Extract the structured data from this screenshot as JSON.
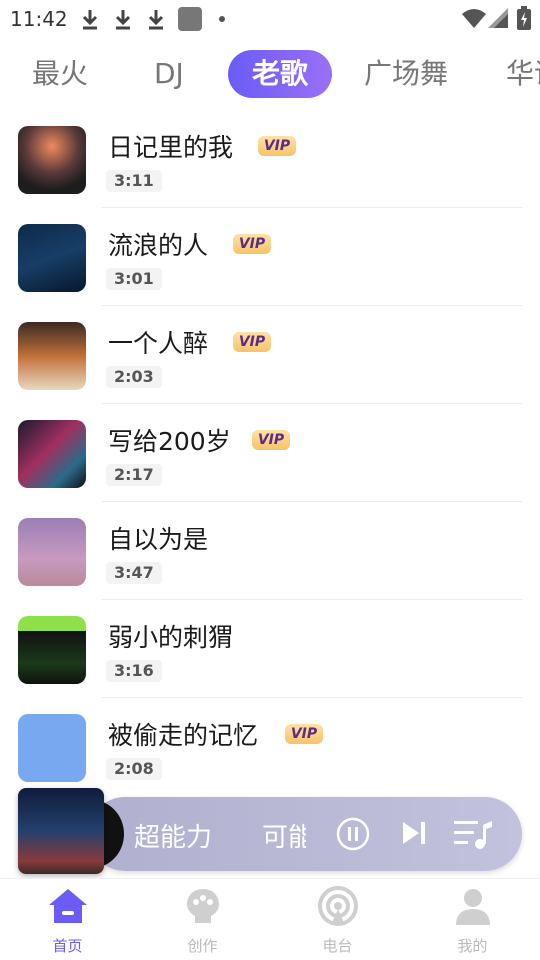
{
  "status_bar": {
    "time": "11:42",
    "icons": [
      "download-icon",
      "download-icon",
      "download-icon",
      "app-notification-icon",
      "dot-icon",
      "wifi-icon",
      "signal-icon",
      "battery-icon"
    ]
  },
  "tabs": {
    "items": [
      {
        "label": "最火"
      },
      {
        "label": "DJ"
      },
      {
        "label": "老歌"
      },
      {
        "label": "广场舞"
      },
      {
        "label": "华语"
      }
    ],
    "active_index": 2,
    "active_color": "#6b5cf6"
  },
  "songs": [
    {
      "title": "日记里的我",
      "duration": "3:11",
      "vip": true,
      "vip_label": "VIP"
    },
    {
      "title": "流浪的人",
      "duration": "3:01",
      "vip": true,
      "vip_label": "VIP"
    },
    {
      "title": "一个人醉",
      "duration": "2:03",
      "vip": true,
      "vip_label": "VIP"
    },
    {
      "title": "写给200岁",
      "duration": "2:17",
      "vip": true,
      "vip_label": "VIP"
    },
    {
      "title": "自以为是",
      "duration": "3:47",
      "vip": false
    },
    {
      "title": "弱小的刺猬",
      "duration": "3:16",
      "vip": false
    },
    {
      "title": "被偷走的记忆",
      "duration": "2:08",
      "vip": true,
      "vip_label": "VIP"
    }
  ],
  "player": {
    "song": "超能力",
    "artist": "可能",
    "state": "playing"
  },
  "bottom_nav": {
    "items": [
      {
        "label": "首页",
        "icon": "home-icon"
      },
      {
        "label": "创作",
        "icon": "create-icon"
      },
      {
        "label": "电台",
        "icon": "radio-icon"
      },
      {
        "label": "我的",
        "icon": "profile-icon"
      }
    ],
    "active_index": 0
  }
}
